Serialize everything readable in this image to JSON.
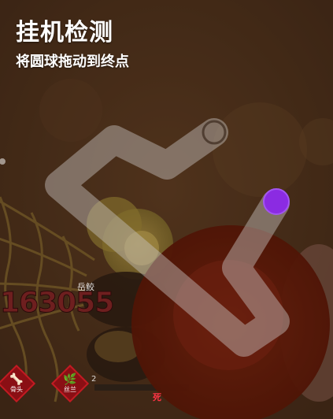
{
  "dialog": {
    "title": "挂机检测",
    "instruction": "将圆球拖动到终点"
  },
  "hud": {
    "score": "163055",
    "player_name": "岳鲛"
  },
  "items": [
    {
      "label": "骨头",
      "glyph": "🦴",
      "icon": "bone-icon"
    },
    {
      "label": "丝兰",
      "glyph": "🌿",
      "icon": "leaf-icon"
    }
  ],
  "bottom_text": {
    "count": "2",
    "label": "死"
  },
  "colors": {
    "ball": "#8b2be2",
    "joystick_base": "#6e0c00",
    "path": "#bfbcb8",
    "background": "#3b2618"
  }
}
